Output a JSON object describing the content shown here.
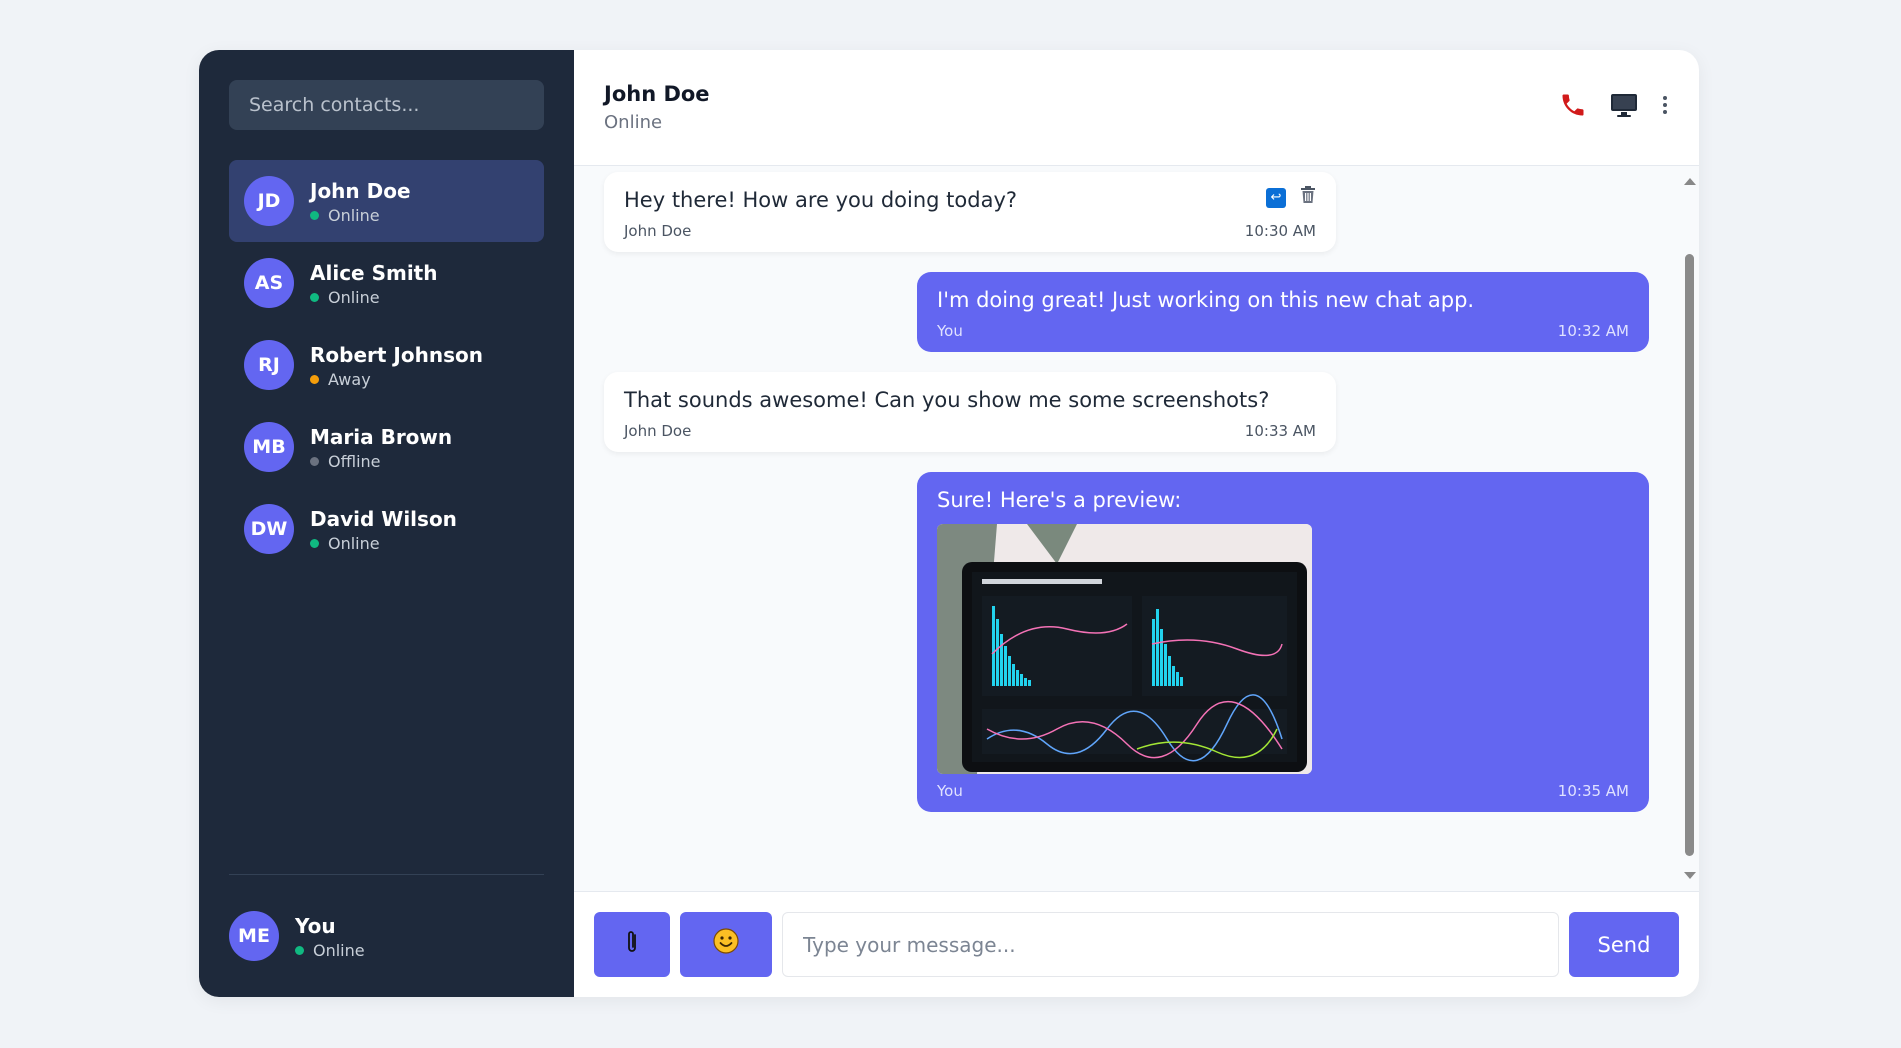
{
  "search": {
    "placeholder": "Search contacts..."
  },
  "contacts": [
    {
      "initials": "JD",
      "name": "John Doe",
      "status": "Online",
      "status_color": "#10b981",
      "active": true
    },
    {
      "initials": "AS",
      "name": "Alice Smith",
      "status": "Online",
      "status_color": "#10b981",
      "active": false
    },
    {
      "initials": "RJ",
      "name": "Robert Johnson",
      "status": "Away",
      "status_color": "#f59e0b",
      "active": false
    },
    {
      "initials": "MB",
      "name": "Maria Brown",
      "status": "Offline",
      "status_color": "#6b7280",
      "active": false
    },
    {
      "initials": "DW",
      "name": "David Wilson",
      "status": "Online",
      "status_color": "#10b981",
      "active": false
    }
  ],
  "me": {
    "initials": "ME",
    "name": "You",
    "status": "Online",
    "status_color": "#10b981"
  },
  "header": {
    "name": "John Doe",
    "status": "Online",
    "icons": [
      "phone-icon",
      "screen-icon",
      "more-icon"
    ]
  },
  "messages": [
    {
      "direction": "in",
      "text": "Hey there! How are you doing today?",
      "sender": "John Doe",
      "time": "10:30 AM",
      "actions": [
        "reply-icon",
        "trash-icon"
      ]
    },
    {
      "direction": "out",
      "text": "I'm doing great! Just working on this new chat app.",
      "sender": "You",
      "time": "10:32 AM"
    },
    {
      "direction": "in",
      "text": "That sounds awesome! Can you show me some screenshots?",
      "sender": "John Doe",
      "time": "10:33 AM"
    },
    {
      "direction": "out",
      "text": "Sure! Here's a preview:",
      "sender": "You",
      "time": "10:35 AM",
      "image": "dashboard-screenshot"
    }
  ],
  "composer": {
    "attach_icon": "paperclip-icon",
    "emoji_icon": "smiley-icon",
    "placeholder": "Type your message...",
    "send_label": "Send"
  },
  "colors": {
    "accent": "#6366f1",
    "sidebar_bg": "#1e293b",
    "active_contact_bg": "#334170"
  }
}
